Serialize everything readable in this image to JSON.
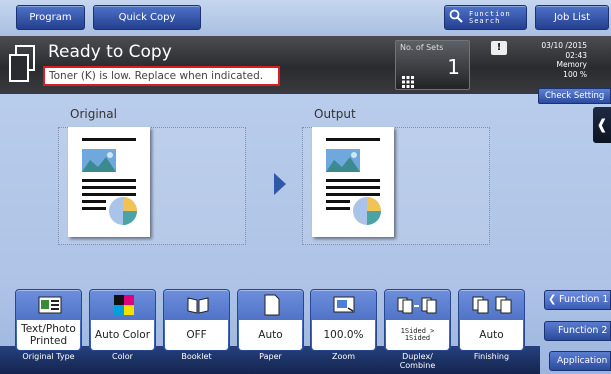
{
  "topbar": {
    "program_label": "Program",
    "quick_copy_label": "Quick Copy",
    "function_search_label": "Function Search",
    "job_list_label": "Job List"
  },
  "status": {
    "title": "Ready to Copy",
    "message": "Toner (K) is low. Replace when indicated.",
    "sets_label": "No. of Sets",
    "sets_value": "1",
    "date": "03/10 /2015",
    "time": "02:43",
    "memory_label": "Memory",
    "memory_value": "100 %",
    "check_setting_label": "Check Setting"
  },
  "preview": {
    "original_label": "Original",
    "output_label": "Output"
  },
  "settings": [
    {
      "caption": "Original Type",
      "value": "Text/Photo Printed",
      "icon": "original-type-icon"
    },
    {
      "caption": "Color",
      "value": "Auto Color",
      "icon": "color-icon"
    },
    {
      "caption": "Booklet",
      "value": "OFF",
      "icon": "booklet-icon"
    },
    {
      "caption": "Paper",
      "value": "Auto",
      "icon": "paper-icon"
    },
    {
      "caption": "Zoom",
      "value": "100.0%",
      "icon": "zoom-icon"
    },
    {
      "caption": "Duplex/ Combine",
      "value": "1Sided > 1Sided",
      "icon": "duplex-icon"
    },
    {
      "caption": "Finishing",
      "value": "Auto",
      "icon": "finishing-icon"
    }
  ],
  "side_panel": {
    "function1": "Function 1",
    "function2": "Function 2",
    "application": "Application"
  },
  "colors": {
    "accent": "#2f58a8",
    "alert_border": "#d81d24",
    "background": "#b4c8e6"
  }
}
